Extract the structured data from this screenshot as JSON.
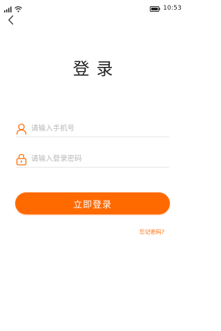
{
  "status_bar": {
    "time": "10:53",
    "icons": [
      "signal-icon",
      "wifi-icon",
      "battery-icon"
    ]
  },
  "nav": {
    "back_icon": "chevron-left-icon"
  },
  "page": {
    "title": "登录"
  },
  "form": {
    "phone": {
      "placeholder": "请输入手机号",
      "value": "",
      "icon": "user-icon"
    },
    "password": {
      "placeholder": "请输入登录密码",
      "value": "",
      "icon": "lock-icon"
    },
    "submit_label": "立即登录",
    "forgot_label": "忘记密码?"
  },
  "colors": {
    "accent": "#ff6a00",
    "placeholder": "#b8b8b8",
    "divider": "#e5e5e5",
    "background": "#ffffff"
  }
}
